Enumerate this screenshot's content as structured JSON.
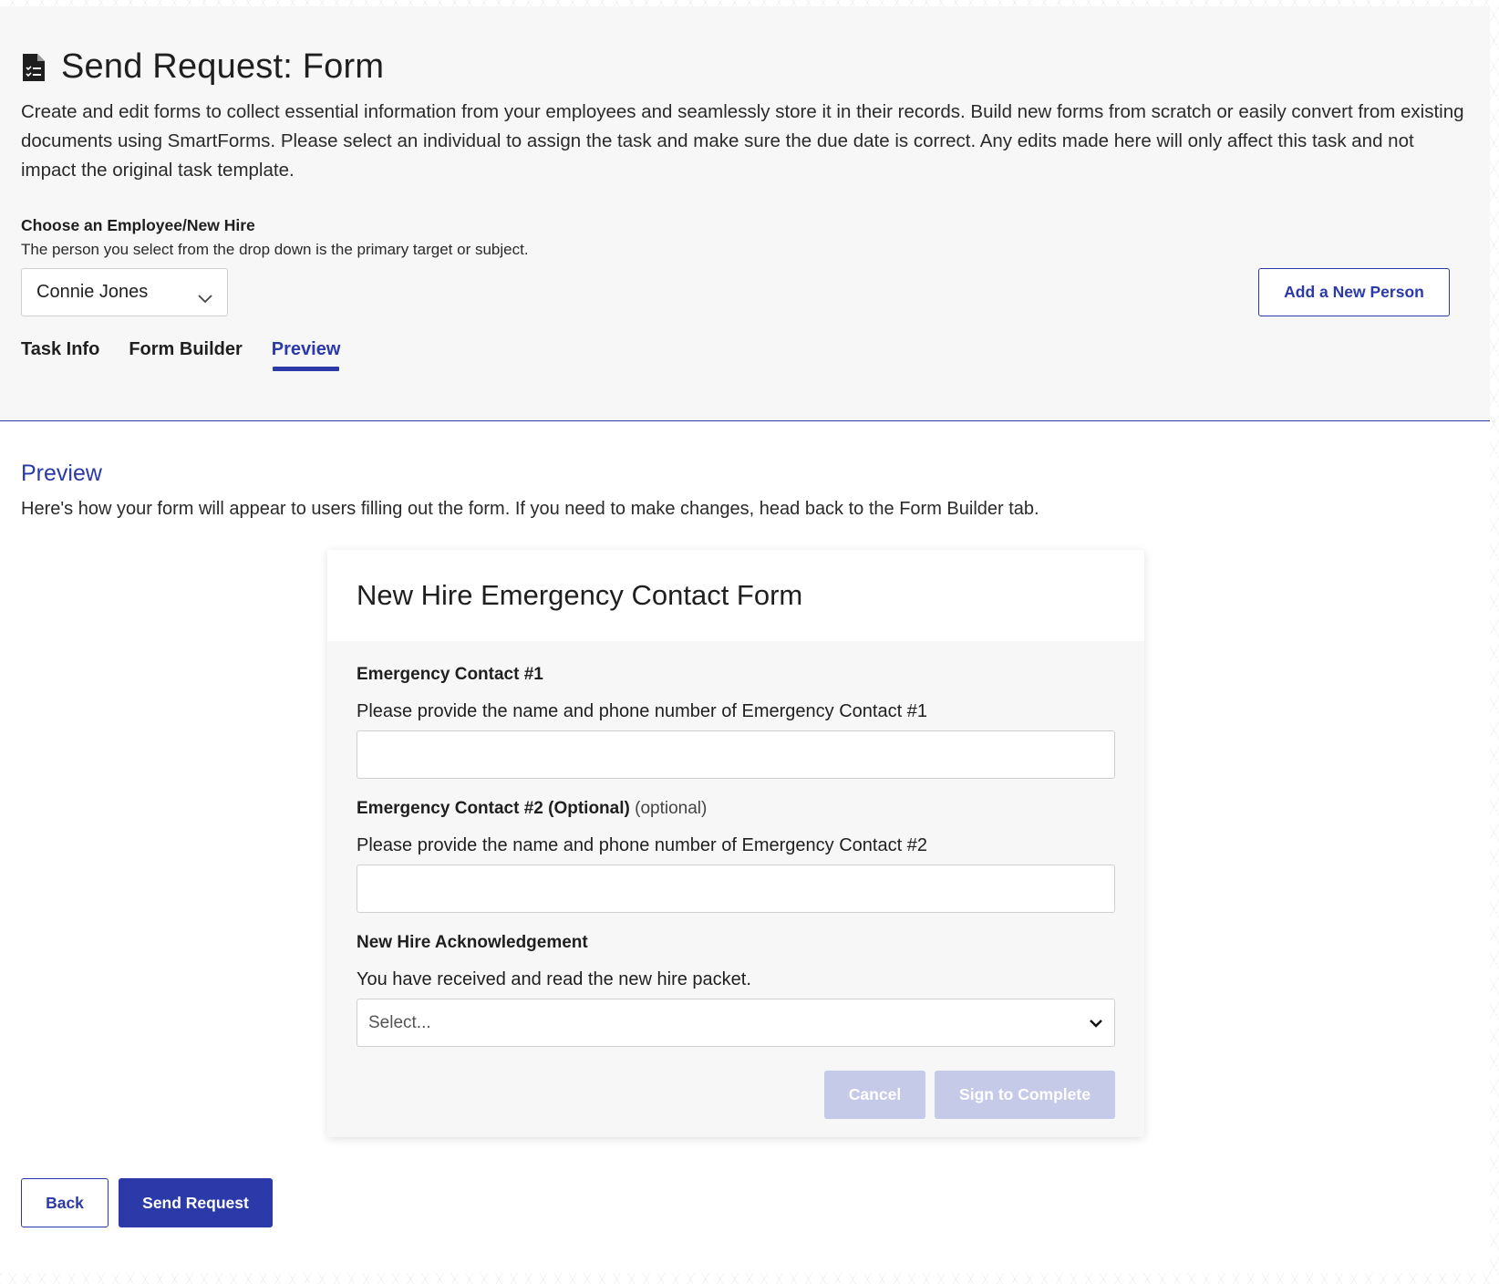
{
  "header": {
    "title": "Send Request: Form",
    "description": "Create and edit forms to collect essential information from your employees and seamlessly store it in their records. Build new forms from scratch or easily convert from existing documents using SmartForms. Please select an individual to assign the task and make sure the due date is correct. Any edits made here will only affect this task and not impact the original task template."
  },
  "employee_picker": {
    "label": "Choose an Employee/New Hire",
    "help": "The person you select from the drop down is the primary target or subject.",
    "selected": "Connie Jones",
    "add_button": "Add a New Person"
  },
  "tabs": [
    {
      "label": "Task Info",
      "active": false
    },
    {
      "label": "Form Builder",
      "active": false
    },
    {
      "label": "Preview",
      "active": true
    }
  ],
  "preview": {
    "heading": "Preview",
    "description": "Here's how your form will appear to users filling out the form. If you need to make changes, head back to the Form Builder tab."
  },
  "form": {
    "title": "New Hire Emergency Contact Form",
    "fields": [
      {
        "label": "Emergency Contact #1",
        "optional_tag": "",
        "prompt": "Please provide the name and phone number of Emergency Contact #1",
        "value": ""
      },
      {
        "label": "Emergency Contact #2 (Optional)",
        "optional_tag": "(optional)",
        "prompt": "Please provide the name and phone number of Emergency Contact #2",
        "value": ""
      },
      {
        "label": "New Hire Acknowledgement",
        "optional_tag": "",
        "prompt": "You have received and read the new hire packet.",
        "placeholder": "Select..."
      }
    ],
    "cancel_label": "Cancel",
    "sign_label": "Sign to Complete"
  },
  "footer": {
    "back_label": "Back",
    "send_label": "Send Request"
  },
  "colors": {
    "accent": "#2b3aa8",
    "disabled_button": "#c5cae9",
    "panel_bg": "#f7f7f7"
  },
  "icons": {
    "title_icon": "document-checklist-icon",
    "dropdown_icon": "chevron-down-icon"
  }
}
